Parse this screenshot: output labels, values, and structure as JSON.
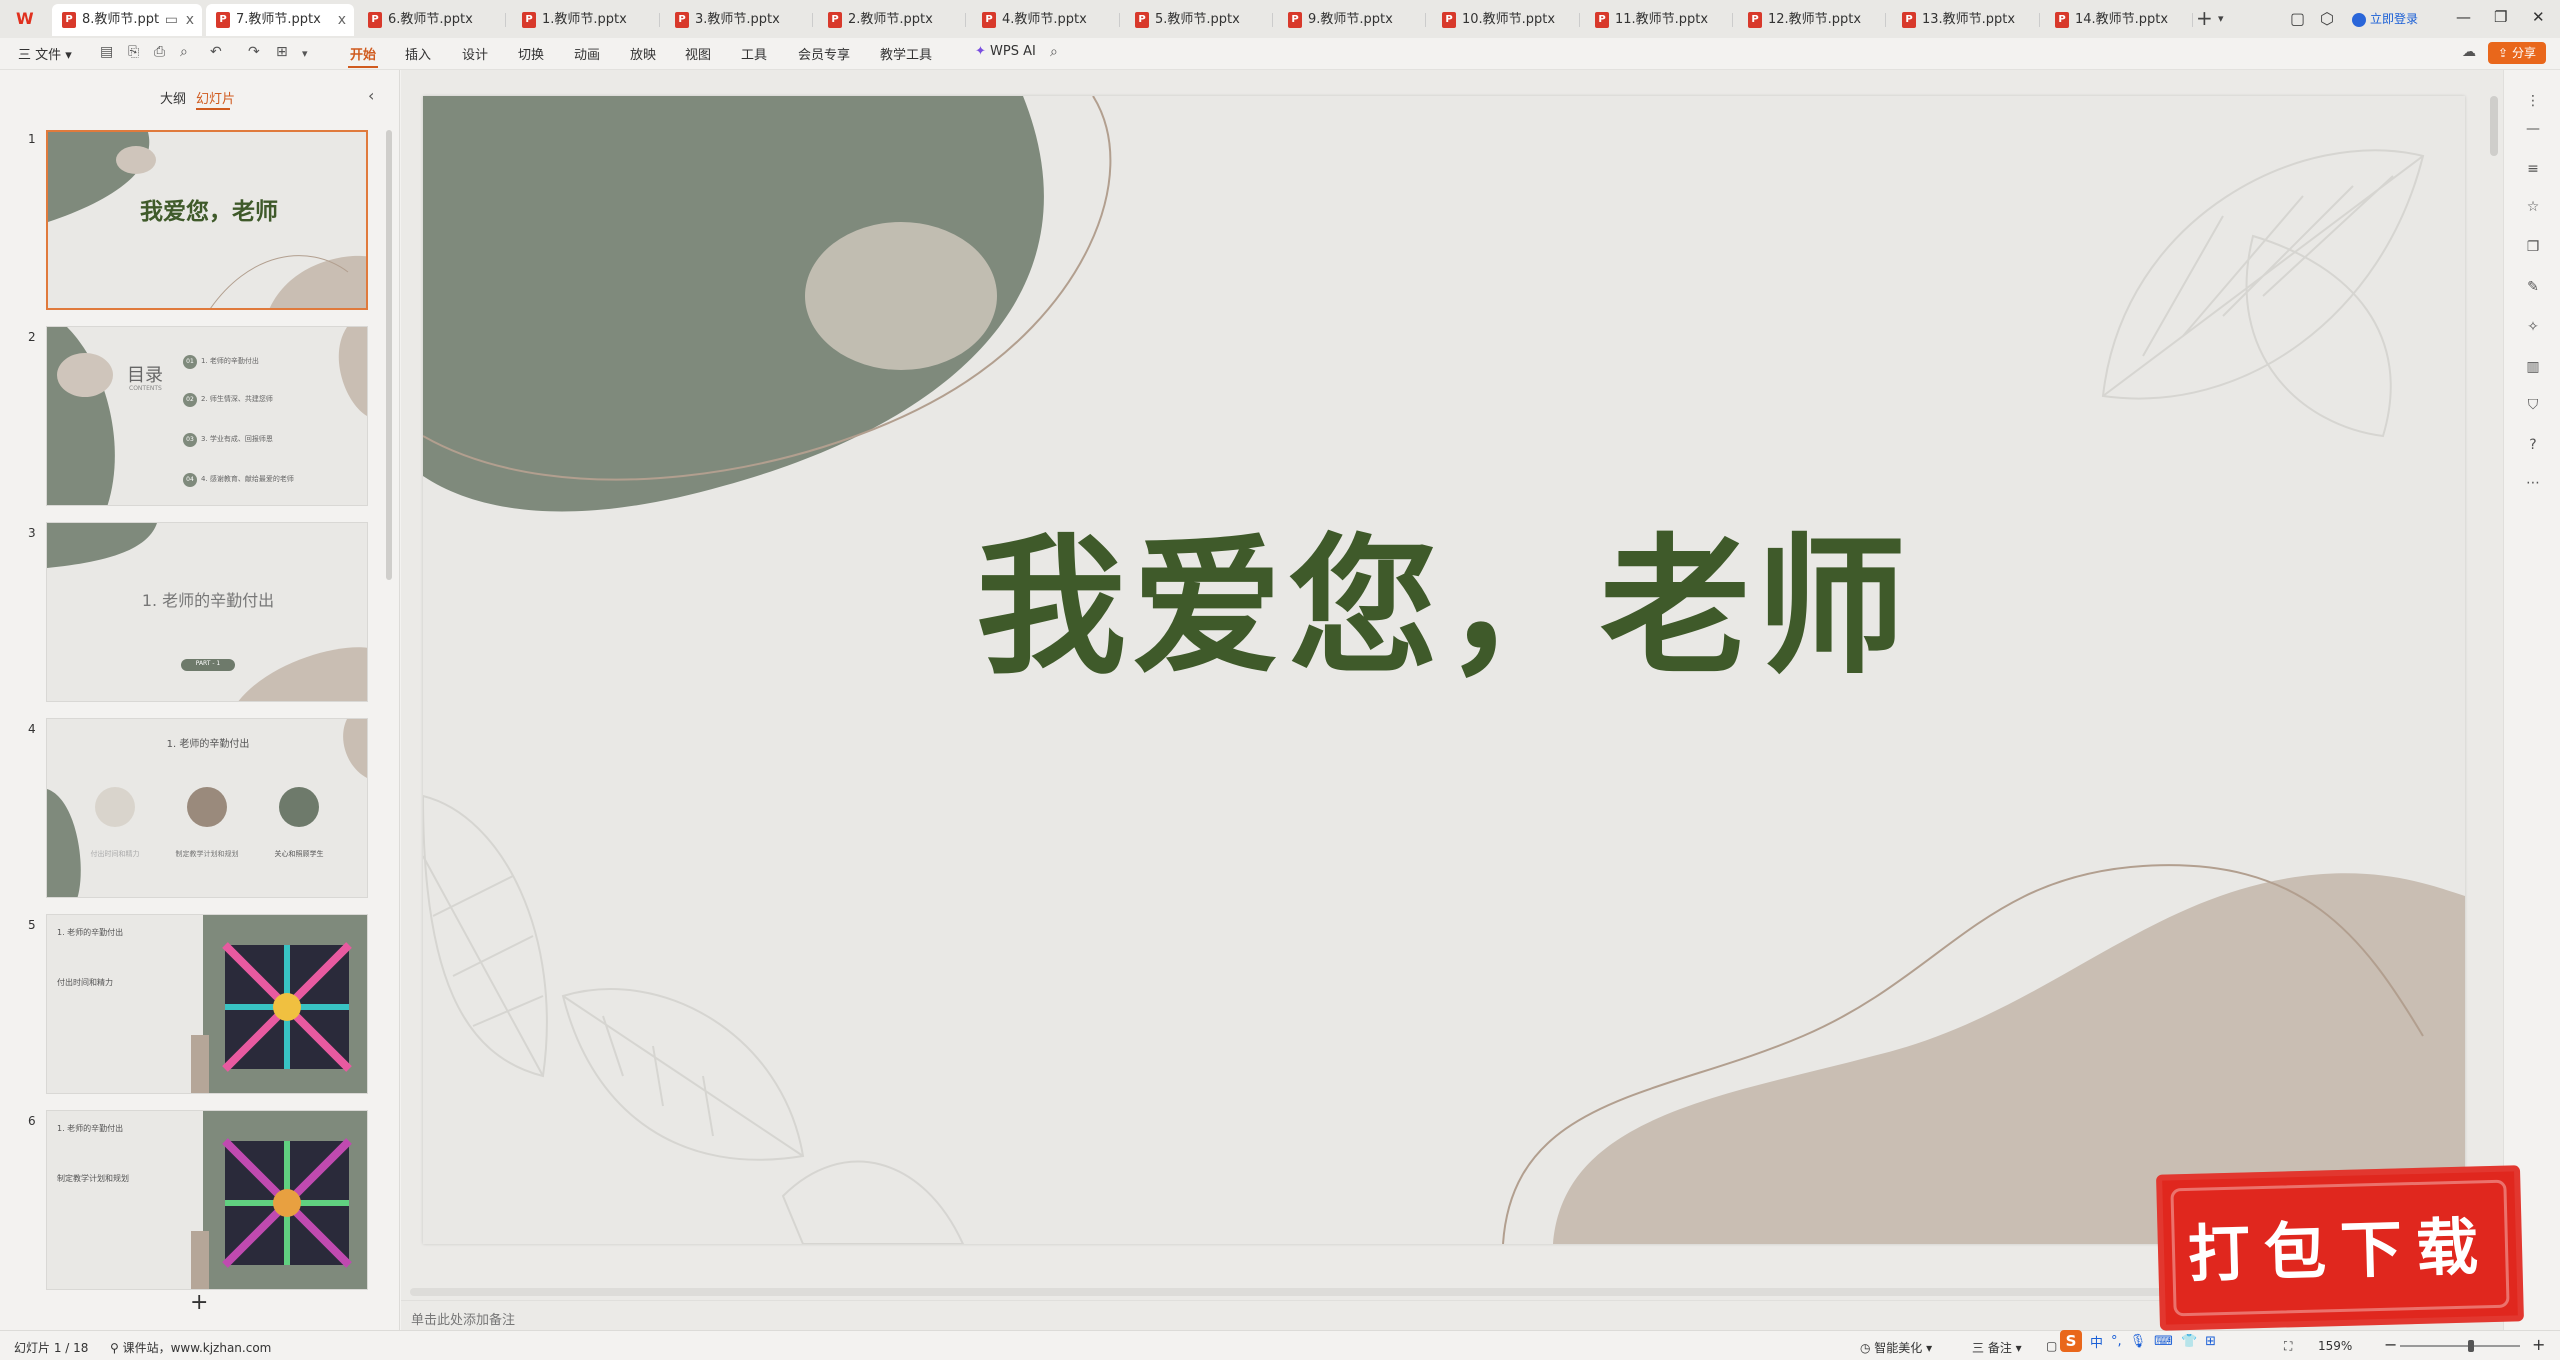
{
  "tabs": [
    {
      "label": "8.教师节.ppt",
      "active": true,
      "close": "x"
    },
    {
      "label": "7.教师节.pptx",
      "active": true,
      "close": "x"
    },
    {
      "label": "6.教师节.pptx"
    },
    {
      "label": "1.教师节.pptx"
    },
    {
      "label": "3.教师节.pptx"
    },
    {
      "label": "2.教师节.pptx"
    },
    {
      "label": "4.教师节.pptx"
    },
    {
      "label": "5.教师节.pptx"
    },
    {
      "label": "9.教师节.pptx"
    },
    {
      "label": "10.教师节.pptx"
    },
    {
      "label": "11.教师节.pptx"
    },
    {
      "label": "12.教师节.pptx"
    },
    {
      "label": "13.教师节.pptx"
    },
    {
      "label": "14.教师节.pptx"
    }
  ],
  "tabbar": {
    "add": "+",
    "login": "立即登录"
  },
  "ribbon": {
    "file": "三 文件 ▾",
    "items": [
      "开始",
      "插入",
      "设计",
      "切换",
      "动画",
      "放映",
      "视图",
      "工具",
      "会员专享",
      "教学工具"
    ],
    "wps_ai": "WPS AI",
    "share": "分享"
  },
  "leftpanel": {
    "tab_outline": "大纲",
    "tab_slides": "幻灯片",
    "slides": [
      {
        "num": "1",
        "title": "我爱您，老师"
      },
      {
        "num": "2",
        "title": "目录",
        "subtitle": "CONTENTS",
        "items": [
          "1. 老师的辛勤付出",
          "2. 师生情深、共建您师",
          "3. 学业有成、回报师恩",
          "4. 感谢教育、献给最爱的老师"
        ],
        "badges": [
          "01",
          "02",
          "03",
          "04"
        ]
      },
      {
        "num": "3",
        "title": "1. 老师的辛勤付出",
        "badge": "PART - 1"
      },
      {
        "num": "4",
        "title": "1. 老师的辛勤付出",
        "labels": [
          "付出时间和精力",
          "制定教学计划和规划",
          "关心和照顾学生"
        ]
      },
      {
        "num": "5",
        "title": "1. 老师的辛勤付出",
        "subtitle": "付出时间和精力"
      },
      {
        "num": "6",
        "title": "1. 老师的辛勤付出",
        "subtitle": "制定教学计划和规划"
      }
    ],
    "add": "+"
  },
  "slide": {
    "title": "我爱您，老师"
  },
  "notes": {
    "placeholder": "单击此处添加备注"
  },
  "statusbar": {
    "slide_info": "幻灯片 1 / 18",
    "site": "课件站，www.kjzhan.com",
    "beautify": "智能美化 ▾",
    "notes": "三 备注 ▾",
    "zoom": "159%"
  },
  "ime": {
    "s": "S",
    "lang": "中"
  },
  "watermark": {
    "text": "打包下载"
  },
  "colors": {
    "accent": "#d05b1f",
    "title_green": "#3f5a2a",
    "sage": "#7f8a7c",
    "beige": "#c9beb3"
  }
}
